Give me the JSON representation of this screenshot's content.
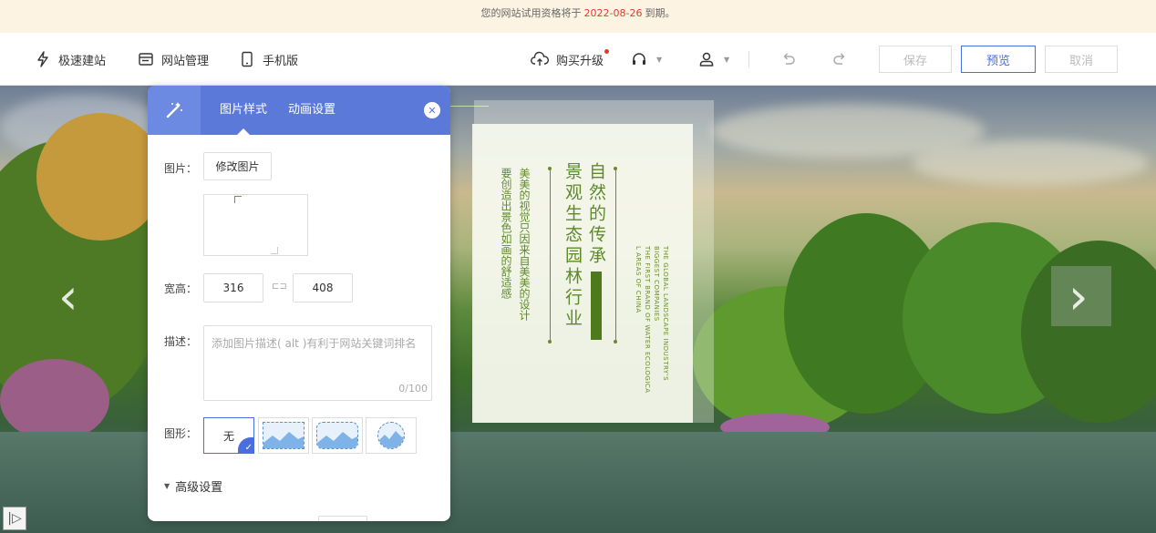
{
  "notice": {
    "prefix": "您的网站试用资格将于",
    "date": "2022-08-26",
    "suffix": "到期。"
  },
  "toolbar": {
    "left": [
      {
        "label": "极速建站",
        "icon": "lightning-icon"
      },
      {
        "label": "网站管理",
        "icon": "window-icon"
      },
      {
        "label": "手机版",
        "icon": "phone-icon"
      }
    ],
    "upgrade_label": "购买升级",
    "save_label": "保存",
    "preview_label": "预览",
    "cancel_label": "取消"
  },
  "panel": {
    "tabs": [
      {
        "label": "图片样式",
        "active": true
      },
      {
        "label": "动画设置",
        "active": false
      }
    ],
    "image_label": "图片：",
    "change_image_label": "修改图片",
    "size_label": "宽高：",
    "width": "316",
    "height": "408",
    "desc_label": "描述：",
    "desc_placeholder": "添加图片描述( alt )有利于网站关键词排名",
    "desc_count": "0/100",
    "shape_label": "图形：",
    "shape_none": "无",
    "advanced_label": "高级设置"
  },
  "poster": {
    "main_col1": "自然的传承",
    "main_col2": "景观生态园林行业",
    "sub_col1": "美美的视觉只因来自美美的设计",
    "sub_col2": "要创造出景色如画的舒适感",
    "en_col1": "THE GLOBAL LANDSCAPE INDUSTRY'S",
    "en_col2": "BIGGEST COMPANIES",
    "en_col3": "THE FIRST BRAND OF WATER ECOLOGICA",
    "en_col4": "L AREAS OF CHINA"
  },
  "colors": {
    "accent": "#4a6ee0",
    "panel_header": "#5a79d9",
    "notice_bg": "#fdf3e2",
    "notice_date": "#e23b2e",
    "poster_green": "#5e8a2c"
  }
}
